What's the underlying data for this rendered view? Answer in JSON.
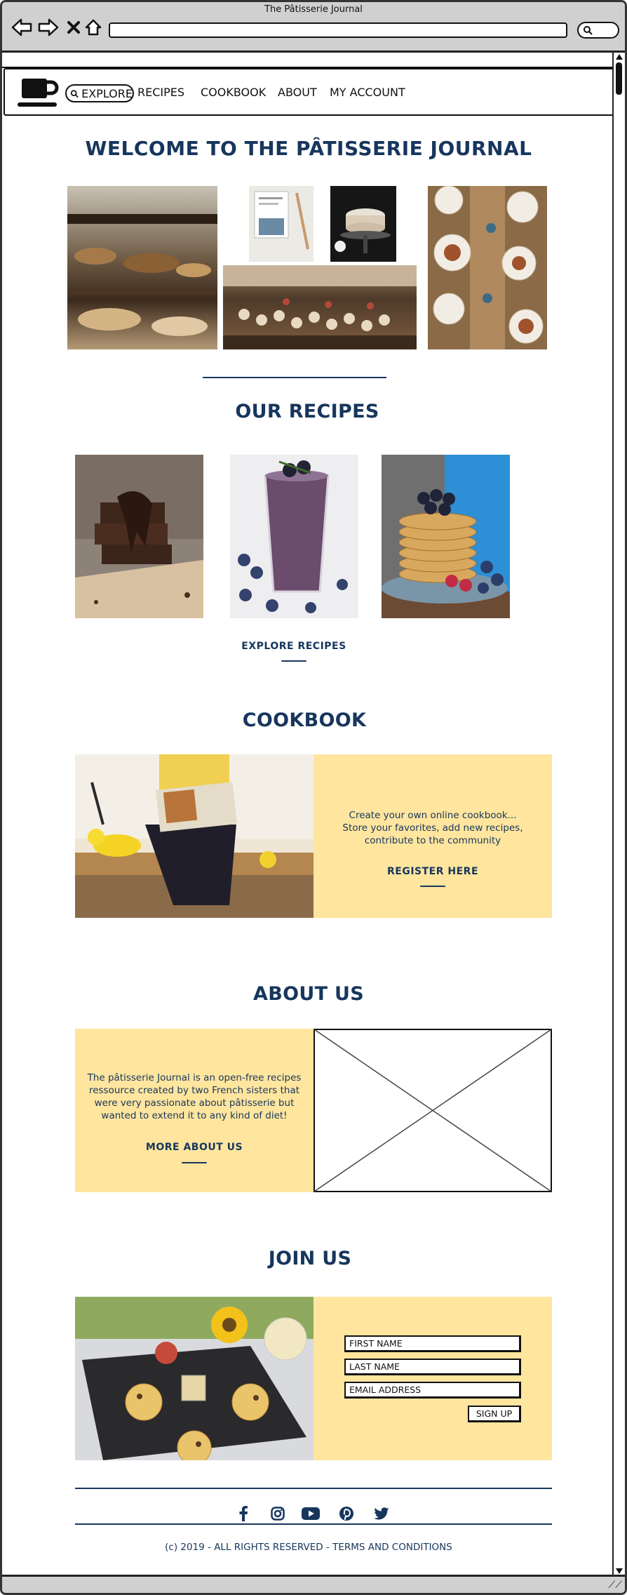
{
  "window": {
    "title": "The Pâtisserie Journal"
  },
  "nav": {
    "explore_label": "EXPLORE",
    "links": [
      "RECIPES",
      "COOKBOOK",
      "ABOUT",
      "MY ACCOUNT"
    ]
  },
  "hero": {
    "title": "WELCOME TO THE PÂTISSERIE JOURNAL"
  },
  "recipes": {
    "title": "OUR RECIPES",
    "cta": "EXPLORE RECIPES"
  },
  "cookbook": {
    "title": "COOKBOOK",
    "lines": [
      "Create your own online cookbook...",
      "Store your favorites, add new recipes,",
      "contribute to the community"
    ],
    "cta": "REGISTER HERE"
  },
  "about": {
    "title": "ABOUT US",
    "lines": [
      "The pâtisserie Journal is an open-free recipes",
      "ressource created by two French sisters that",
      "were very passionate about pâtisserie but",
      "wanted to extend it to any kind of diet!"
    ],
    "cta": "MORE ABOUT US"
  },
  "join": {
    "title": "JOIN US",
    "first_name_placeholder": "FIRST NAME",
    "last_name_placeholder": "LAST NAME",
    "email_placeholder": "EMAIL ADDRESS",
    "signup_label": "SIGN UP"
  },
  "social_icons": [
    "facebook-icon",
    "instagram-icon",
    "youtube-icon",
    "pinterest-icon",
    "twitter-icon"
  ],
  "footer": {
    "text": "(c) 2019 - ALL RIGHTS RESERVED - TERMS AND CONDITIONS"
  },
  "colors": {
    "accent": "#17365d",
    "panel": "#ffe59e",
    "chrome": "#d0d0d0"
  }
}
